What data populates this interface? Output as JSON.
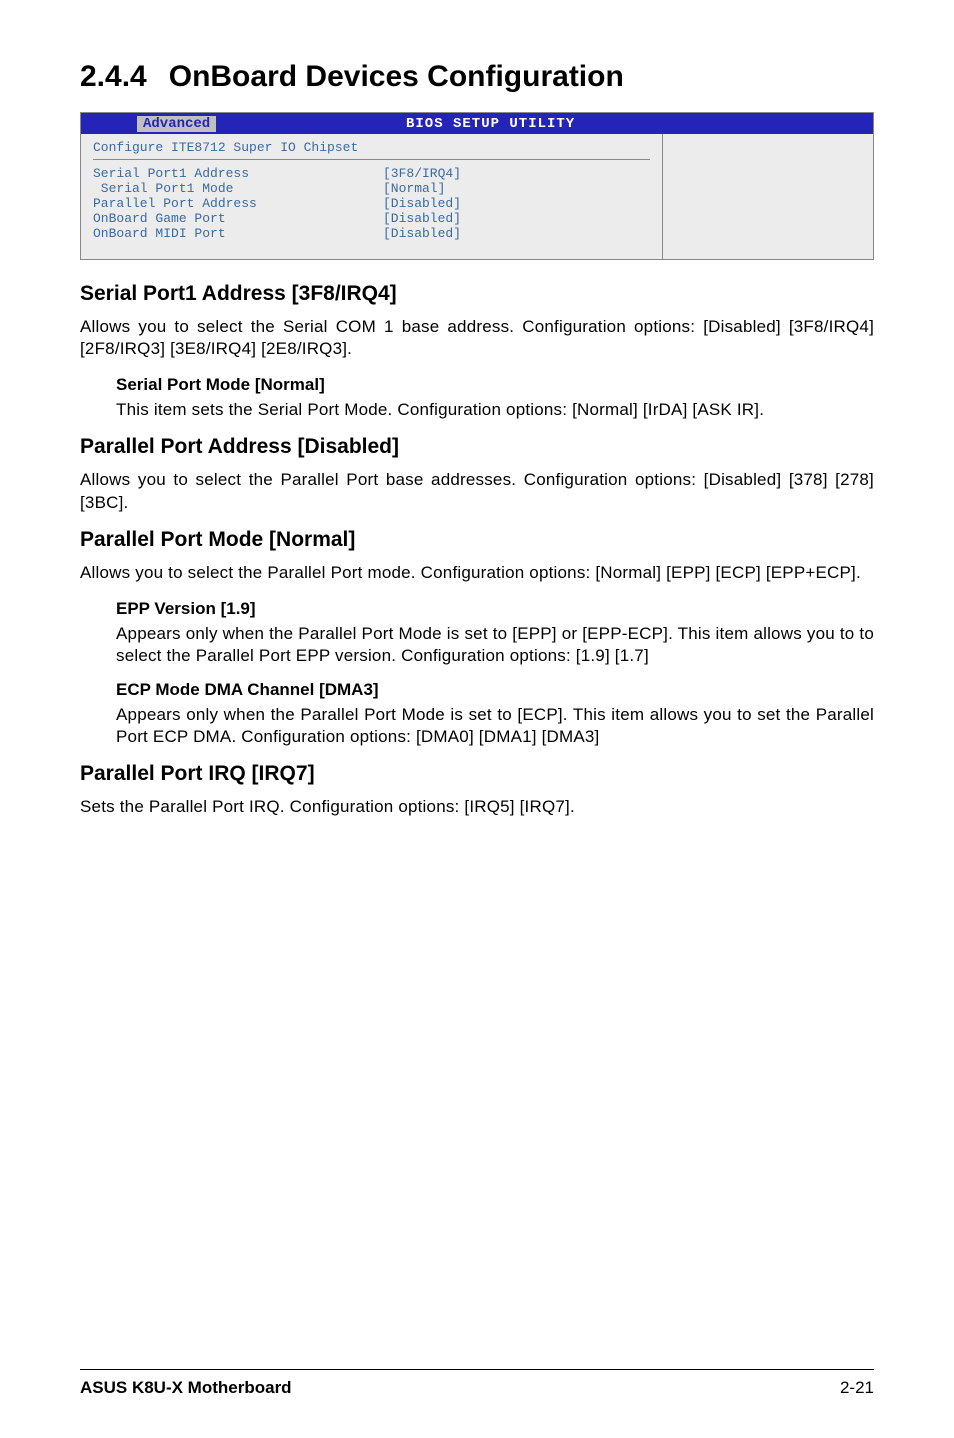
{
  "heading": {
    "number": "2.4.4",
    "title": "OnBoard Devices Configuration"
  },
  "bios": {
    "headerTitle": "BIOS SETUP UTILITY",
    "tab": "Advanced",
    "subheader": "Configure ITE8712 Super IO Chipset",
    "rows": [
      {
        "label": "Serial Port1 Address",
        "value": "[3F8/IRQ4]"
      },
      {
        "label": " Serial Port1 Mode",
        "value": "[Normal]"
      },
      {
        "label": "Parallel Port Address",
        "value": "[Disabled]"
      },
      {
        "label": "OnBoard Game Port",
        "value": "[Disabled]"
      },
      {
        "label": "OnBoard MIDI Port",
        "value": "[Disabled]"
      }
    ]
  },
  "sections": [
    {
      "heading": "Serial Port1 Address [3F8/IRQ4]",
      "body": "Allows you to select the Serial COM 1 base address. Configuration options: [Disabled] [3F8/IRQ4] [2F8/IRQ3] [3E8/IRQ4] [2E8/IRQ3].",
      "indents": [
        {
          "heading": "Serial Port Mode [Normal]",
          "text": "This item sets the Serial Port Mode. Configuration options: [Normal] [IrDA] [ASK IR]."
        }
      ]
    },
    {
      "heading": "Parallel Port Address [Disabled]",
      "body": "Allows you to select the Parallel Port base addresses. Configuration options: [Disabled] [378] [278] [3BC].",
      "indents": []
    },
    {
      "heading": "Parallel Port Mode [Normal]",
      "body": "Allows you to select the Parallel Port mode. Configuration options: [Normal] [EPP] [ECP] [EPP+ECP].",
      "indents": [
        {
          "heading": "EPP Version [1.9]",
          "text": "Appears only when the Parallel Port Mode is set to [EPP] or [EPP-ECP]. This item allows you to to select the Parallel Port EPP version. Configuration options: [1.9] [1.7]"
        },
        {
          "heading": "ECP Mode DMA Channel [DMA3]",
          "text": "Appears only when the Parallel Port Mode is set to [ECP]. This item allows you to set the Parallel Port ECP DMA. Configuration options: [DMA0] [DMA1] [DMA3]"
        }
      ]
    },
    {
      "heading": "Parallel Port IRQ [IRQ7]",
      "body": "Sets the Parallel Port IRQ. Configuration options: [IRQ5] [IRQ7].",
      "indents": []
    }
  ],
  "footer": {
    "left": "ASUS K8U-X Motherboard",
    "right": "2-21"
  }
}
